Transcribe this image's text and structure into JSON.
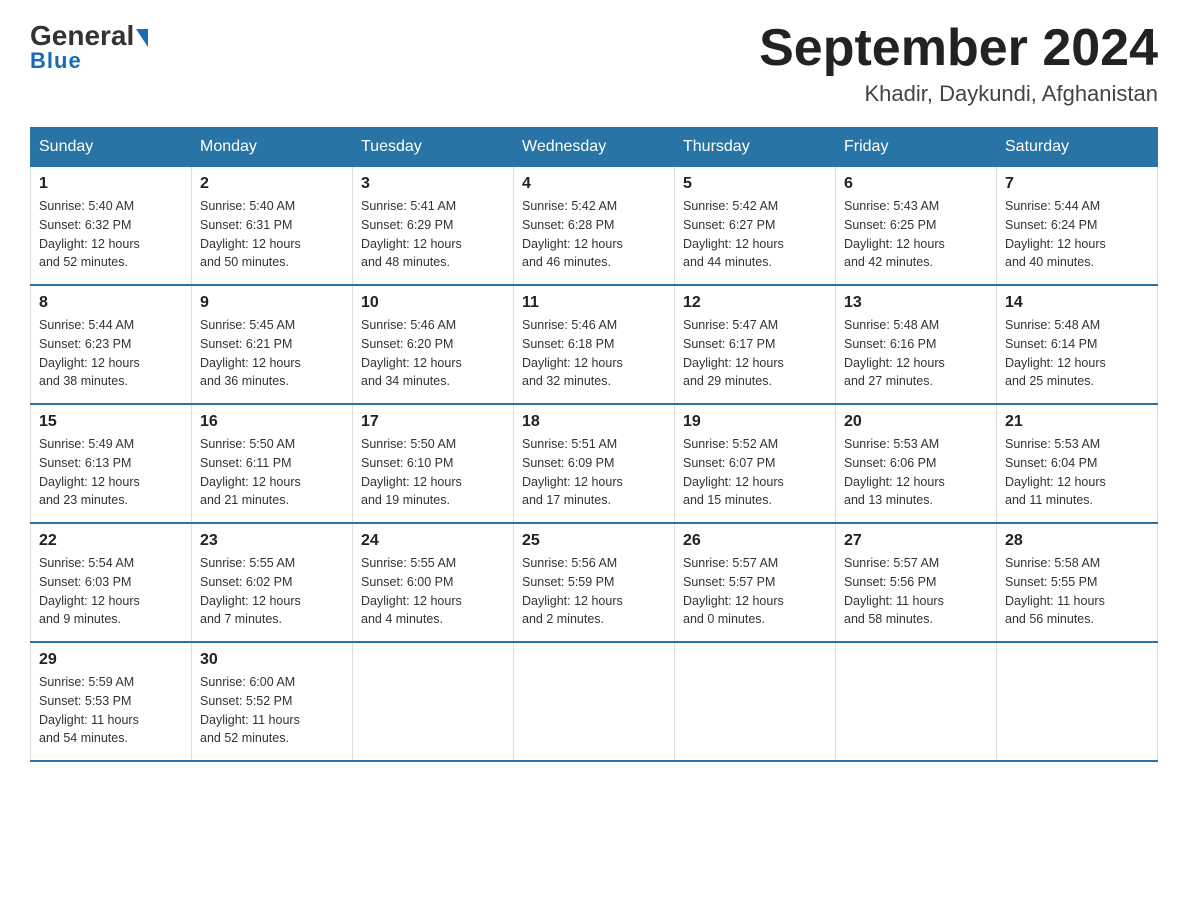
{
  "logo": {
    "general": "General",
    "blue": "Blue",
    "underline": "Blue"
  },
  "header": {
    "month_year": "September 2024",
    "location": "Khadir, Daykundi, Afghanistan"
  },
  "days_of_week": [
    "Sunday",
    "Monday",
    "Tuesday",
    "Wednesday",
    "Thursday",
    "Friday",
    "Saturday"
  ],
  "weeks": [
    [
      {
        "day": "1",
        "sunrise": "5:40 AM",
        "sunset": "6:32 PM",
        "daylight": "12 hours and 52 minutes."
      },
      {
        "day": "2",
        "sunrise": "5:40 AM",
        "sunset": "6:31 PM",
        "daylight": "12 hours and 50 minutes."
      },
      {
        "day": "3",
        "sunrise": "5:41 AM",
        "sunset": "6:29 PM",
        "daylight": "12 hours and 48 minutes."
      },
      {
        "day": "4",
        "sunrise": "5:42 AM",
        "sunset": "6:28 PM",
        "daylight": "12 hours and 46 minutes."
      },
      {
        "day": "5",
        "sunrise": "5:42 AM",
        "sunset": "6:27 PM",
        "daylight": "12 hours and 44 minutes."
      },
      {
        "day": "6",
        "sunrise": "5:43 AM",
        "sunset": "6:25 PM",
        "daylight": "12 hours and 42 minutes."
      },
      {
        "day": "7",
        "sunrise": "5:44 AM",
        "sunset": "6:24 PM",
        "daylight": "12 hours and 40 minutes."
      }
    ],
    [
      {
        "day": "8",
        "sunrise": "5:44 AM",
        "sunset": "6:23 PM",
        "daylight": "12 hours and 38 minutes."
      },
      {
        "day": "9",
        "sunrise": "5:45 AM",
        "sunset": "6:21 PM",
        "daylight": "12 hours and 36 minutes."
      },
      {
        "day": "10",
        "sunrise": "5:46 AM",
        "sunset": "6:20 PM",
        "daylight": "12 hours and 34 minutes."
      },
      {
        "day": "11",
        "sunrise": "5:46 AM",
        "sunset": "6:18 PM",
        "daylight": "12 hours and 32 minutes."
      },
      {
        "day": "12",
        "sunrise": "5:47 AM",
        "sunset": "6:17 PM",
        "daylight": "12 hours and 29 minutes."
      },
      {
        "day": "13",
        "sunrise": "5:48 AM",
        "sunset": "6:16 PM",
        "daylight": "12 hours and 27 minutes."
      },
      {
        "day": "14",
        "sunrise": "5:48 AM",
        "sunset": "6:14 PM",
        "daylight": "12 hours and 25 minutes."
      }
    ],
    [
      {
        "day": "15",
        "sunrise": "5:49 AM",
        "sunset": "6:13 PM",
        "daylight": "12 hours and 23 minutes."
      },
      {
        "day": "16",
        "sunrise": "5:50 AM",
        "sunset": "6:11 PM",
        "daylight": "12 hours and 21 minutes."
      },
      {
        "day": "17",
        "sunrise": "5:50 AM",
        "sunset": "6:10 PM",
        "daylight": "12 hours and 19 minutes."
      },
      {
        "day": "18",
        "sunrise": "5:51 AM",
        "sunset": "6:09 PM",
        "daylight": "12 hours and 17 minutes."
      },
      {
        "day": "19",
        "sunrise": "5:52 AM",
        "sunset": "6:07 PM",
        "daylight": "12 hours and 15 minutes."
      },
      {
        "day": "20",
        "sunrise": "5:53 AM",
        "sunset": "6:06 PM",
        "daylight": "12 hours and 13 minutes."
      },
      {
        "day": "21",
        "sunrise": "5:53 AM",
        "sunset": "6:04 PM",
        "daylight": "12 hours and 11 minutes."
      }
    ],
    [
      {
        "day": "22",
        "sunrise": "5:54 AM",
        "sunset": "6:03 PM",
        "daylight": "12 hours and 9 minutes."
      },
      {
        "day": "23",
        "sunrise": "5:55 AM",
        "sunset": "6:02 PM",
        "daylight": "12 hours and 7 minutes."
      },
      {
        "day": "24",
        "sunrise": "5:55 AM",
        "sunset": "6:00 PM",
        "daylight": "12 hours and 4 minutes."
      },
      {
        "day": "25",
        "sunrise": "5:56 AM",
        "sunset": "5:59 PM",
        "daylight": "12 hours and 2 minutes."
      },
      {
        "day": "26",
        "sunrise": "5:57 AM",
        "sunset": "5:57 PM",
        "daylight": "12 hours and 0 minutes."
      },
      {
        "day": "27",
        "sunrise": "5:57 AM",
        "sunset": "5:56 PM",
        "daylight": "11 hours and 58 minutes."
      },
      {
        "day": "28",
        "sunrise": "5:58 AM",
        "sunset": "5:55 PM",
        "daylight": "11 hours and 56 minutes."
      }
    ],
    [
      {
        "day": "29",
        "sunrise": "5:59 AM",
        "sunset": "5:53 PM",
        "daylight": "11 hours and 54 minutes."
      },
      {
        "day": "30",
        "sunrise": "6:00 AM",
        "sunset": "5:52 PM",
        "daylight": "11 hours and 52 minutes."
      },
      null,
      null,
      null,
      null,
      null
    ]
  ],
  "labels": {
    "sunrise": "Sunrise:",
    "sunset": "Sunset:",
    "daylight": "Daylight:"
  }
}
